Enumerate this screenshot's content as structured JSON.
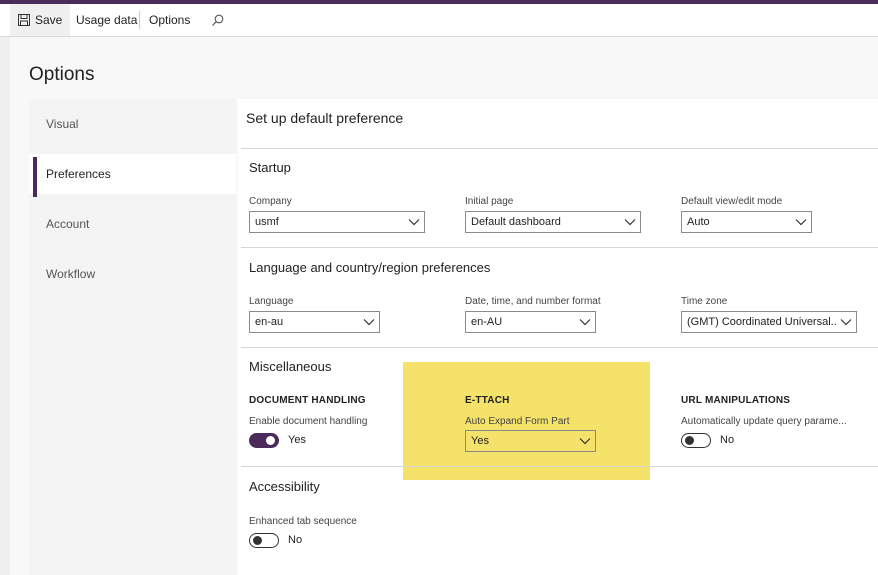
{
  "toolbar": {
    "save_label": "Save",
    "usage_label": "Usage data",
    "options_label": "Options"
  },
  "page": {
    "title": "Options"
  },
  "sidebar": {
    "items": [
      {
        "label": "Visual"
      },
      {
        "label": "Preferences"
      },
      {
        "label": "Account"
      },
      {
        "label": "Workflow"
      }
    ],
    "active": "Preferences"
  },
  "content": {
    "title": "Set up default preference",
    "startup": {
      "title": "Startup",
      "company_label": "Company",
      "company_value": "usmf",
      "initial_page_label": "Initial page",
      "initial_page_value": "Default dashboard",
      "view_mode_label": "Default view/edit mode",
      "view_mode_value": "Auto"
    },
    "language": {
      "title": "Language and country/region preferences",
      "language_label": "Language",
      "language_value": "en-au",
      "format_label": "Date, time, and number format",
      "format_value": "en-AU",
      "timezone_label": "Time zone",
      "timezone_value": "(GMT) Coordinated Universal..."
    },
    "misc": {
      "title": "Miscellaneous",
      "doc_group": "DOCUMENT HANDLING",
      "doc_label": "Enable document handling",
      "doc_value": "Yes",
      "ettach_group": "E-TTACH",
      "ettach_label": "Auto Expand Form Part",
      "ettach_value": "Yes",
      "url_group": "URL MANIPULATIONS",
      "url_label": "Automatically update query parame...",
      "url_value": "No"
    },
    "accessibility": {
      "title": "Accessibility",
      "tab_label": "Enhanced tab sequence",
      "tab_value": "No"
    }
  },
  "colors": {
    "accent": "#4b2b59",
    "highlight": "#f5e26a"
  }
}
